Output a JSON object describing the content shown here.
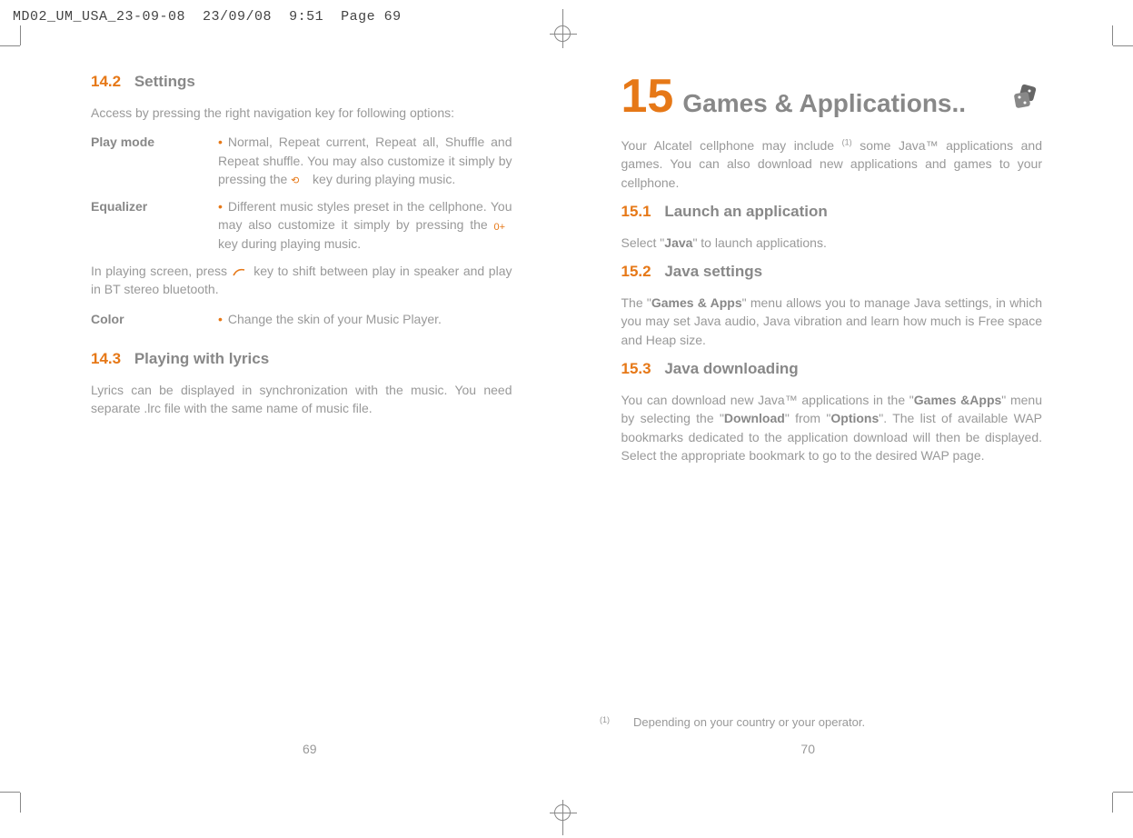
{
  "header": {
    "filename": "MD02_UM_USA_23-09-08",
    "date": "23/09/08",
    "time": "9:51",
    "page_label": "Page 69"
  },
  "left_page": {
    "sec_14_2": {
      "num": "14.2",
      "title": "Settings"
    },
    "intro_14_2": "Access by pressing the right navigation key for following options:",
    "playmode": {
      "term": "Play mode",
      "desc_a": "Normal, Repeat current, Repeat all, Shuffle and Repeat shuffle. You may also customize it simply by pressing the ",
      "desc_b": " key during playing music."
    },
    "equalizer": {
      "term": "Equalizer",
      "desc_a": "Different music styles preset in the cellphone. You may also customize it simply by pressing the ",
      "key_label": "0+",
      "desc_b": " key during playing music."
    },
    "playing_note_a": "In playing screen, press ",
    "playing_note_b": " key to shift between play in speaker and play in BT stereo bluetooth.",
    "color": {
      "term": "Color",
      "desc": "Change the skin of your Music Player."
    },
    "sec_14_3": {
      "num": "14.3",
      "title": "Playing with lyrics"
    },
    "lyrics_text": "Lyrics can be displayed in synchronization with the music. You need separate .lrc file with the same name of music file.",
    "page_num": "69"
  },
  "right_page": {
    "chapter": {
      "num": "15",
      "title": "Games & Applications.."
    },
    "intro_a": "Your Alcatel cellphone may include ",
    "intro_sup": "(1)",
    "intro_b": " some Java™ applications and games. You can also download new applications and games to your cellphone.",
    "sec_15_1": {
      "num": "15.1",
      "title": "Launch an application"
    },
    "text_15_1_a": "Select \"",
    "text_15_1_bold": "Java",
    "text_15_1_b": "\" to launch applications.",
    "sec_15_2": {
      "num": "15.2",
      "title": "Java settings"
    },
    "text_15_2_a": "The \"",
    "text_15_2_bold1": "Games & Apps",
    "text_15_2_b": "\" menu allows you to manage Java settings, in which you may set Java audio, Java vibration and learn how much is Free space and Heap size.",
    "sec_15_3": {
      "num": "15.3",
      "title": "Java downloading"
    },
    "text_15_3_a": "You can download new Java™ applications in the \"",
    "text_15_3_bold1": "Games &Apps",
    "text_15_3_b": "\" menu by selecting the \"",
    "text_15_3_bold2": "Download",
    "text_15_3_c": "\" from \"",
    "text_15_3_bold3": "Options",
    "text_15_3_d": "\". The list of available WAP bookmarks dedicated to the application download will then be displayed. Select the appropriate bookmark to go to the desired WAP page.",
    "footnote": {
      "marker": "(1)",
      "text": "Depending on your country or your operator."
    },
    "page_num": "70"
  }
}
